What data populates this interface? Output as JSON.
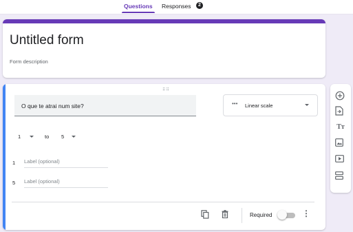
{
  "tabs": {
    "questions": "Questions",
    "responses": "Responses",
    "responses_count": "2"
  },
  "form": {
    "title": "Untitled form",
    "description": "Form description"
  },
  "question": {
    "text": "O que te atrai num site?",
    "type": "Linear scale",
    "scale_from": "1",
    "scale_to_word": "to",
    "scale_to": "5",
    "label_min_number": "1",
    "label_min_placeholder": "Label (optional)",
    "label_max_number": "5",
    "label_max_placeholder": "Label (optional)",
    "required_label": "Required",
    "required": false
  },
  "colors": {
    "accent": "#673ab7",
    "active_card": "#4285f4",
    "background": "#efebf7"
  },
  "toolbar": {
    "items": [
      "add-question",
      "import-questions",
      "add-title",
      "add-image",
      "add-video",
      "add-section"
    ]
  }
}
